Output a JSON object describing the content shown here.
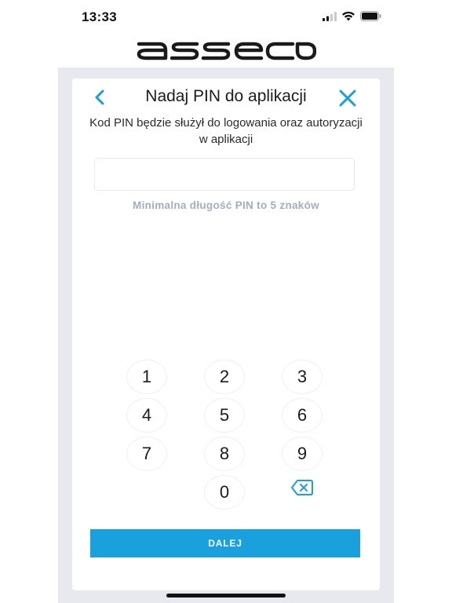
{
  "status_bar": {
    "time": "13:33",
    "icons": [
      "signal-icon",
      "wifi-icon",
      "battery-icon"
    ]
  },
  "logo": {
    "text": "asseco"
  },
  "header": {
    "title": "Nadaj PIN do aplikacji",
    "back_icon": "chevron-left-icon",
    "close_icon": "close-icon"
  },
  "subtitle": "Kod PIN będzie służył do logowania oraz autoryzacji w aplikacji",
  "pin_input": {
    "value": "",
    "placeholder": ""
  },
  "hint": "Minimalna długość PIN to 5 znaków",
  "keypad": {
    "keys": [
      "1",
      "2",
      "3",
      "4",
      "5",
      "6",
      "7",
      "8",
      "9",
      "0"
    ],
    "delete_icon": "backspace-icon"
  },
  "submit_label": "DALEJ",
  "colors": {
    "accent": "#1aa1dd",
    "frame": "#e7e9ee",
    "hint": "#a4adbf"
  }
}
